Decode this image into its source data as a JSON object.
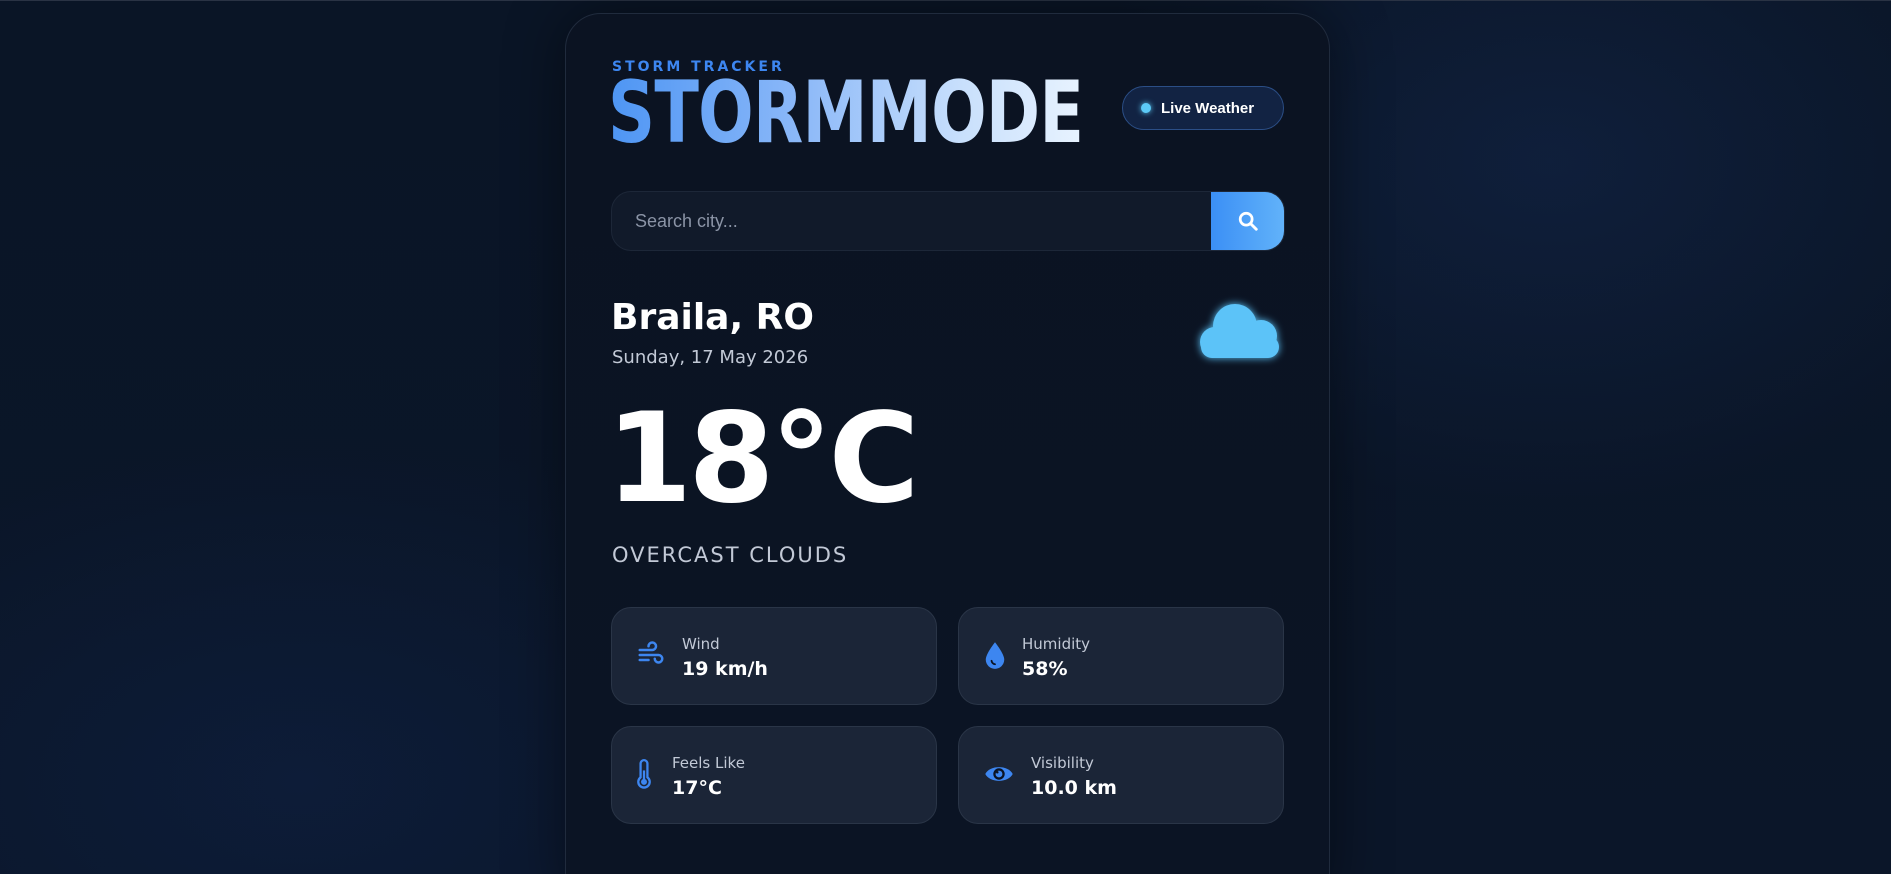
{
  "header": {
    "eyebrow": "STORM TRACKER",
    "brand": "STORMMODE",
    "live_badge": "Live Weather"
  },
  "search": {
    "placeholder": "Search city...",
    "button_icon": "search-icon"
  },
  "location": {
    "city": "Braila, RO",
    "date": "Sunday, 17 May 2026",
    "weather_icon": "cloud-icon"
  },
  "current": {
    "temperature": "18°C",
    "condition": "OVERCAST CLOUDS"
  },
  "stats": [
    {
      "label": "Wind",
      "value": "19 km/h",
      "icon": "wind-icon"
    },
    {
      "label": "Humidity",
      "value": "58%",
      "icon": "droplet-icon"
    },
    {
      "label": "Feels Like",
      "value": "17°C",
      "icon": "thermometer-icon"
    },
    {
      "label": "Visibility",
      "value": "10.0 km",
      "icon": "eye-icon"
    }
  ],
  "colors": {
    "accent": "#3d86f0",
    "accent_light": "#62b3fa",
    "cloud": "#5cc3f8",
    "background": "#0a1424",
    "card": "#1b2537"
  }
}
